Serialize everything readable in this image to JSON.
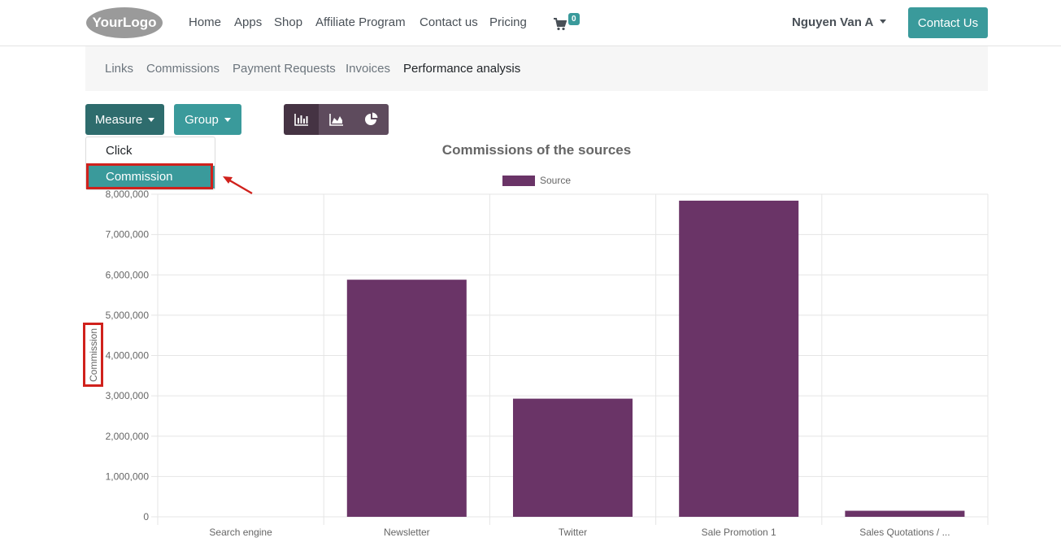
{
  "navbar": {
    "logo_text": "YourLogo",
    "links": [
      "Home",
      "Apps",
      "Shop",
      "Affiliate Program",
      "Contact us",
      "Pricing"
    ],
    "cart_count": "0",
    "user_name": "Nguyen Van A",
    "contact_button": "Contact Us"
  },
  "subnav": {
    "links": [
      "Links",
      "Commissions",
      "Payment Requests",
      "Invoices",
      "Performance analysis"
    ],
    "active": "Performance analysis"
  },
  "toolbar": {
    "measure_label": "Measure",
    "group_label": "Group",
    "views": [
      "bar-chart-icon",
      "area-chart-icon",
      "pie-chart-icon"
    ],
    "active_view": "bar-chart-icon"
  },
  "measure_dropdown": {
    "items": [
      "Click",
      "Commission"
    ],
    "selected": "Commission"
  },
  "colors": {
    "accent": "#3a9a9b",
    "accent_dark": "#2e6c6d",
    "bar": "#6a3467",
    "highlight": "#d0211c"
  },
  "chart_data": {
    "type": "bar",
    "title": "Commissions of the sources",
    "ylabel": "Commission",
    "xlabel": "",
    "categories": [
      "Search engine",
      "Newsletter",
      "Twitter",
      "Sale Promotion 1",
      "Sales Quotations / ..."
    ],
    "series": [
      {
        "name": "Source",
        "values": [
          0,
          5880000,
          2930000,
          7840000,
          150000
        ]
      }
    ],
    "ylim": [
      0,
      8000000
    ],
    "yticks": [
      "0",
      "1,000,000",
      "2,000,000",
      "3,000,000",
      "4,000,000",
      "5,000,000",
      "6,000,000",
      "7,000,000",
      "8,000,000"
    ],
    "grid": true,
    "legend_position": "top"
  }
}
